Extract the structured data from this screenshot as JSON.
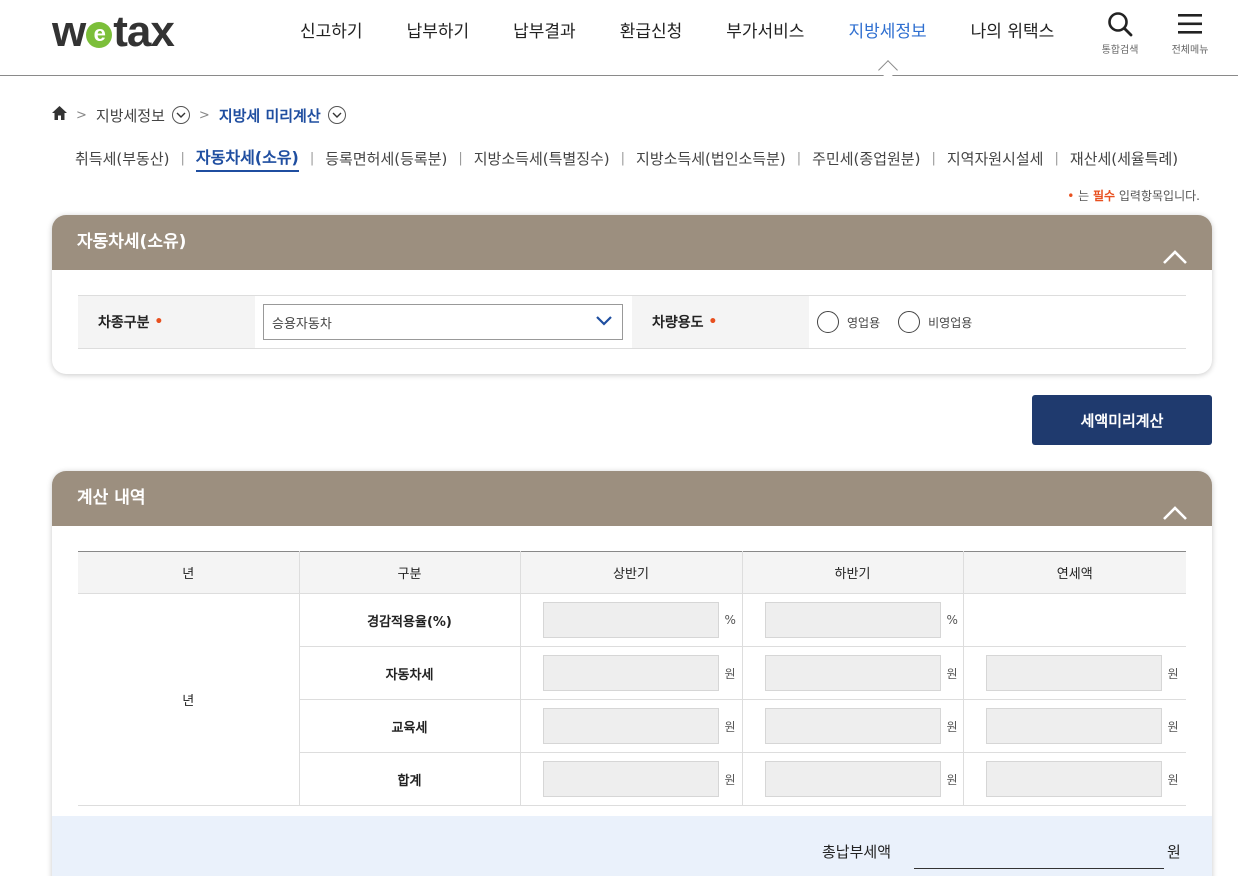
{
  "header": {
    "logo": {
      "pre": "w",
      "e": "e",
      "post": "tax"
    },
    "nav": [
      "신고하기",
      "납부하기",
      "납부결과",
      "환급신청",
      "부가서비스",
      "지방세정보",
      "나의 위택스"
    ],
    "active_nav": "지방세정보",
    "search_label": "통합검색",
    "menu_label": "전체메뉴"
  },
  "breadcrumb": {
    "level1": "지방세정보",
    "level2": "지방세 미리계산"
  },
  "subtabs": [
    "취득세(부동산)",
    "자동차세(소유)",
    "등록면허세(등록분)",
    "지방소득세(특별징수)",
    "지방소득세(법인소득분)",
    "주민세(종업원분)",
    "지역자원시설세",
    "재산세(세율특례)"
  ],
  "active_subtab": "자동차세(소유)",
  "required_note": {
    "dot": "•",
    "pre": "는 ",
    "must": "필수",
    "post": " 입력항목입니다."
  },
  "form_panel": {
    "title": "자동차세(소유)",
    "vehicle_type_label": "차종구분",
    "vehicle_type_value": "승용자동차",
    "usage_label": "차량용도",
    "usage_options": [
      "영업용",
      "비영업용"
    ],
    "required_mark": "•"
  },
  "calc_button": "세액미리계산",
  "result_panel": {
    "title": "계산 내역",
    "headers": [
      "년",
      "구분",
      "상반기",
      "하반기",
      "연세액"
    ],
    "year_cell": "년",
    "rows": [
      {
        "label": "경감적용율(%)",
        "unit": "%"
      },
      {
        "label": "자동차세",
        "unit": "원"
      },
      {
        "label": "교육세",
        "unit": "원"
      },
      {
        "label": "합계",
        "unit": "원"
      }
    ],
    "total_label": "총납부세액",
    "total_unit": "원"
  },
  "colors": {
    "panel_head": "#9c8f7f",
    "primary_button": "#1f3a6e",
    "active_link": "#2f6fd0",
    "required": "#e8501f"
  }
}
